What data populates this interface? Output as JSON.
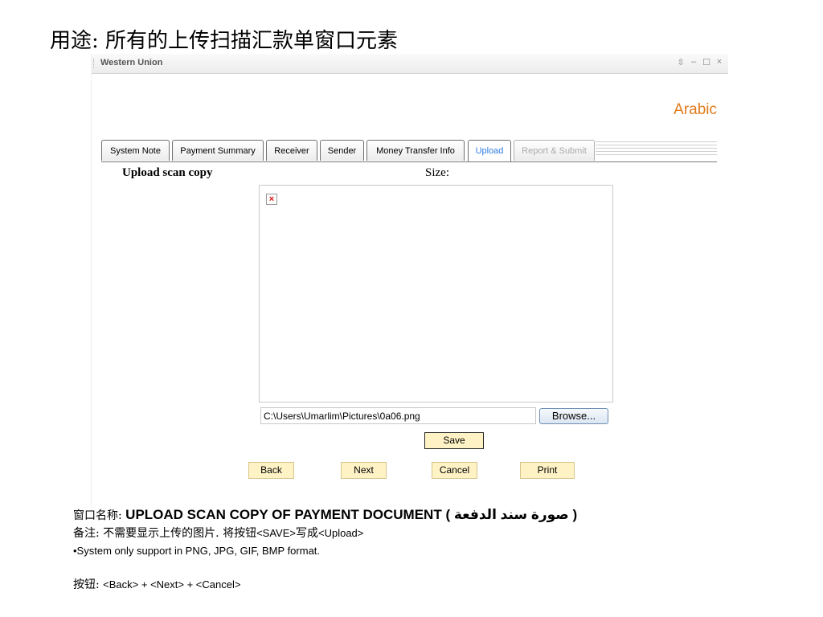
{
  "slide": {
    "title": "用途: 所有的上传扫描汇款单窗口元素"
  },
  "window": {
    "app_title": "Western Union",
    "controls": [
      "⇳",
      "–",
      "☐",
      "×"
    ],
    "language_link": "Arabic"
  },
  "tabs": [
    {
      "label": "System Note",
      "state": "normal"
    },
    {
      "label": "Payment Summary",
      "state": "normal"
    },
    {
      "label": "Receiver",
      "state": "normal"
    },
    {
      "label": "Sender",
      "state": "normal"
    },
    {
      "label": "Money Transfer Info",
      "state": "normal"
    },
    {
      "label": "Upload",
      "state": "active"
    },
    {
      "label": "Report & Submit",
      "state": "disabled"
    }
  ],
  "upload": {
    "heading": "Upload scan copy",
    "size_label": "Size:",
    "broken_image_glyph": "×",
    "file_path": "C:\\Users\\Umarlim\\Pictures\\0a06.png",
    "browse_label": "Browse...",
    "save_label": "Save"
  },
  "nav": {
    "back_label": "Back",
    "next_label": "Next",
    "cancel_label": "Cancel",
    "print_label": "Print"
  },
  "notes": {
    "window_name_prefix": "窗口名称: ",
    "window_name": "UPLOAD SCAN COPY  OF PAYMENT DOCUMENT ( صورة سند الدفعة )",
    "remark_prefix": "备注: 不需要显示上传的图片. 将按钮",
    "remark_save": "<SAVE>",
    "remark_mid": "写成",
    "remark_upload": "<Upload>",
    "format_note": "•System only support in PNG, JPG, GIF, BMP format.",
    "buttons_prefix": "按钮: ",
    "buttons_list": " <Back>  +  <Next>  +  <Cancel>"
  },
  "colors": {
    "accent_orange": "#e07b1a",
    "active_tab": "#2f7de1",
    "button_yellow": "#fff3c6"
  }
}
